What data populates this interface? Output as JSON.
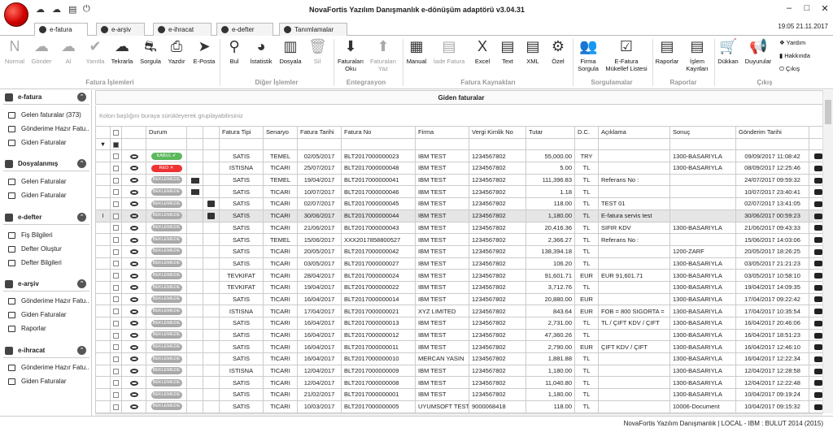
{
  "window": {
    "title": "NovaFortis Yazılım Danışmanlık e-dönüşüm adaptörü v3.04.31",
    "clock": "19:05 21.11.2017"
  },
  "tabs": [
    {
      "label": "e-fatura"
    },
    {
      "label": "e-arşiv"
    },
    {
      "label": "e-ihracat"
    },
    {
      "label": "e-defter"
    },
    {
      "label": "Tanımlamalar"
    }
  ],
  "ribbon": {
    "fatura": {
      "group": "Fatura İşlemleri",
      "normal": "Normal",
      "gonder": "Gönder",
      "al": "Al",
      "yanitla": "Yanıtla",
      "tekrarla": "Tekrarla",
      "sorgula": "Sorgula",
      "yazdir": "Yazdır",
      "eposta": "E-Posta"
    },
    "diger": {
      "group": "Diğer İşlemler",
      "bul": "Bul",
      "istatistik": "İstatistik",
      "dosyala": "Dosyala",
      "sil": "Sil"
    },
    "entegrasyon": {
      "group": "Entegrasyon",
      "oku": "Faturaları Oku",
      "yaz": "Faturaları Yaz"
    },
    "kaynak": {
      "group": "Fatura Kaynakları",
      "manual": "Manual",
      "iade": "İade Fatura",
      "excel": "Excel",
      "text": "Text",
      "xml": "XML",
      "ozel": "Özel"
    },
    "sorgu": {
      "group": "Sorgulamalar",
      "firma": "Firma Sorgula",
      "mukellef": "E-Fatura Mükellef Listesi"
    },
    "raporlar": {
      "group": "Raporlar",
      "raporlar": "Raporlar",
      "islem": "İşlem Kayıtları"
    },
    "cikis": {
      "group": "Çıkış",
      "dukkan": "Dükkan",
      "duyurular": "Duyurular",
      "yardim": "Yardım",
      "hakkinda": "Hakkında",
      "cikis": "Çıkış"
    }
  },
  "sidebar": {
    "efatura": {
      "title": "e-fatura",
      "items": [
        "Gelen faturalar (373)",
        "Gönderime Hazır Fatu...",
        "Giden Faturalar"
      ]
    },
    "dosyalanmis": {
      "title": "Dosyalanmış",
      "items": [
        "Gelen Faturalar",
        "Giden Faturalar"
      ]
    },
    "edefter": {
      "title": "e-defter",
      "items": [
        "Fiş Bilgileri",
        "Defter Oluştur",
        "Defter Bilgileri"
      ]
    },
    "earsiv": {
      "title": "e-arşiv",
      "items": [
        "Gönderime Hazır Fatu...",
        "Giden Faturalar",
        "Raporlar"
      ]
    },
    "eihracat": {
      "title": "e-ihracat",
      "items": [
        "Gönderime Hazır Fatu...",
        "Giden Faturalar"
      ]
    }
  },
  "grid": {
    "title": "Giden faturalar",
    "group_hint": "Kolon başlığını buraya sürükleyerek gruplayabilirsiniz",
    "columns": [
      "Durum",
      "Fatura Tipi",
      "Senaryo",
      "Fatura Tarihi",
      "Fatura No",
      "Firma",
      "Vergi Kimlik No",
      "Tutar",
      "D.C.",
      "Açıklama",
      "Sonuç",
      "Gönderim Tarihi"
    ],
    "rows": [
      {
        "durum": "KABUL",
        "mail": false,
        "print": false,
        "tip": "SATIS",
        "senaryo": "TEMEL",
        "tarih": "02/05/2017",
        "no": "BLT2017000000023",
        "firma": "IBM TEST",
        "vkn": "1234567802",
        "tutar": "55,000.00",
        "dc": "TRY",
        "aciklama": "",
        "sonuc": "1300-BASARIYLA",
        "gonderim": "09/09/2017 11:08:42"
      },
      {
        "durum": "RED",
        "mail": false,
        "print": false,
        "tip": "ISTISNA",
        "senaryo": "TICARI",
        "tarih": "25/07/2017",
        "no": "BLT2017000000048",
        "firma": "IBM TEST",
        "vkn": "1234567802",
        "tutar": "5.00",
        "dc": "TL",
        "aciklama": "",
        "sonuc": "1300-BASARIYLA",
        "gonderim": "08/09/2017 12:25:46"
      },
      {
        "durum": "BEKLEMEDE",
        "mail": true,
        "print": false,
        "tip": "SATIS",
        "senaryo": "TEMEL",
        "tarih": "19/04/2017",
        "no": "BLT2017000000041",
        "firma": "IBM TEST",
        "vkn": "1234567802",
        "tutar": "111,396.83",
        "dc": "TL",
        "aciklama": "Referans No :",
        "sonuc": "",
        "gonderim": "24/07/2017 09:59:32"
      },
      {
        "durum": "BEKLEMEDE",
        "mail": true,
        "print": false,
        "tip": "SATIS",
        "senaryo": "TICARI",
        "tarih": "10/07/2017",
        "no": "BLT2017000000046",
        "firma": "IBM TEST",
        "vkn": "1234567802",
        "tutar": "1.18",
        "dc": "TL",
        "aciklama": "",
        "sonuc": "",
        "gonderim": "10/07/2017 23:40:41"
      },
      {
        "durum": "BEKLEMEDE",
        "mail": false,
        "print": true,
        "tip": "SATIS",
        "senaryo": "TICARI",
        "tarih": "02/07/2017",
        "no": "BLT2017000000045",
        "firma": "IBM TEST",
        "vkn": "1234567802",
        "tutar": "118.00",
        "dc": "TL",
        "aciklama": "TEST 01",
        "sonuc": "",
        "gonderim": "02/07/2017 13:41:05"
      },
      {
        "durum": "BEKLEMEDE",
        "mail": false,
        "print": true,
        "tip": "SATIS",
        "senaryo": "TICARI",
        "tarih": "30/06/2017",
        "no": "BLT2017000000044",
        "firma": "IBM TEST",
        "vkn": "1234567802",
        "tutar": "1,180.00",
        "dc": "TL",
        "aciklama": "E-fatura servis test",
        "sonuc": "",
        "gonderim": "30/06/2017 00:59:23",
        "sel": true
      },
      {
        "durum": "BEKLEMEDE",
        "mail": false,
        "print": false,
        "tip": "SATIS",
        "senaryo": "TICARI",
        "tarih": "21/06/2017",
        "no": "BLT2017000000043",
        "firma": "IBM TEST",
        "vkn": "1234567802",
        "tutar": "20,416.36",
        "dc": "TL",
        "aciklama": "SIFIR KDV",
        "sonuc": "1300-BASARIYLA",
        "gonderim": "21/06/2017 09:43:33"
      },
      {
        "durum": "BEKLEMEDE",
        "mail": false,
        "print": false,
        "tip": "SATIS",
        "senaryo": "TEMEL",
        "tarih": "15/06/2017",
        "no": "XXX2017858800527",
        "firma": "IBM TEST",
        "vkn": "1234567802",
        "tutar": "2,366.27",
        "dc": "TL",
        "aciklama": "Referans No :",
        "sonuc": "",
        "gonderim": "15/06/2017 14:03:06"
      },
      {
        "durum": "BEKLEMEDE",
        "mail": false,
        "print": false,
        "tip": "SATIS",
        "senaryo": "TICARI",
        "tarih": "20/05/2017",
        "no": "BLT2017000000042",
        "firma": "IBM TEST",
        "vkn": "1234567802",
        "tutar": "138,394.18",
        "dc": "TL",
        "aciklama": "",
        "sonuc": "1200-ZARF",
        "gonderim": "20/05/2017 18:26:25"
      },
      {
        "durum": "BEKLEMEDE",
        "mail": false,
        "print": false,
        "tip": "SATIS",
        "senaryo": "TICARI",
        "tarih": "03/05/2017",
        "no": "BLT2017000000027",
        "firma": "IBM TEST",
        "vkn": "1234567802",
        "tutar": "106.20",
        "dc": "TL",
        "aciklama": "",
        "sonuc": "1300-BASARIYLA",
        "gonderim": "03/05/2017 21:21:23"
      },
      {
        "durum": "BEKLEMEDE",
        "mail": false,
        "print": false,
        "tip": "TEVKIFAT",
        "senaryo": "TICARI",
        "tarih": "28/04/2017",
        "no": "BLT2017000000024",
        "firma": "IBM TEST",
        "vkn": "1234567802",
        "tutar": "91,601.71",
        "dc": "EUR",
        "aciklama": "EUR 91,601.71",
        "sonuc": "1300-BASARIYLA",
        "gonderim": "03/05/2017 10:58:10"
      },
      {
        "durum": "BEKLEMEDE",
        "mail": false,
        "print": false,
        "tip": "TEVKIFAT",
        "senaryo": "TICARI",
        "tarih": "19/04/2017",
        "no": "BLT2017000000022",
        "firma": "IBM TEST",
        "vkn": "1234567802",
        "tutar": "3,712.76",
        "dc": "TL",
        "aciklama": "",
        "sonuc": "1300-BASARIYLA",
        "gonderim": "19/04/2017 14:09:35"
      },
      {
        "durum": "BEKLEMEDE",
        "mail": false,
        "print": false,
        "tip": "SATIS",
        "senaryo": "TICARI",
        "tarih": "16/04/2017",
        "no": "BLT2017000000014",
        "firma": "IBM TEST",
        "vkn": "1234567802",
        "tutar": "20,880.00",
        "dc": "EUR",
        "aciklama": "",
        "sonuc": "1300-BASARIYLA",
        "gonderim": "17/04/2017 09:22:42"
      },
      {
        "durum": "BEKLEMEDE",
        "mail": false,
        "print": false,
        "tip": "ISTISNA",
        "senaryo": "TICARI",
        "tarih": "17/04/2017",
        "no": "BLT2017000000021",
        "firma": "XYZ LIMITED",
        "vkn": "1234567802",
        "tutar": "843.64",
        "dc": "EUR",
        "aciklama": "FOB = 800 SIGORTA =",
        "sonuc": "1300-BASARIYLA",
        "gonderim": "17/04/2017 10:35:54"
      },
      {
        "durum": "BEKLEMEDE",
        "mail": false,
        "print": false,
        "tip": "SATIS",
        "senaryo": "TICARI",
        "tarih": "16/04/2017",
        "no": "BLT2017000000013",
        "firma": "IBM TEST",
        "vkn": "1234567802",
        "tutar": "2,731.00",
        "dc": "TL",
        "aciklama": "TL / ÇIFT KDV / ÇIFT",
        "sonuc": "1300-BASARIYLA",
        "gonderim": "16/04/2017 20:46:06"
      },
      {
        "durum": "BEKLEMEDE",
        "mail": false,
        "print": false,
        "tip": "SATIS",
        "senaryo": "TICARI",
        "tarih": "16/04/2017",
        "no": "BLT2017000000012",
        "firma": "IBM TEST",
        "vkn": "1234567802",
        "tutar": "47,360.26",
        "dc": "TL",
        "aciklama": "",
        "sonuc": "1300-BASARIYLA",
        "gonderim": "16/04/2017 18:51:23"
      },
      {
        "durum": "BEKLEMEDE",
        "mail": false,
        "print": false,
        "tip": "SATIS",
        "senaryo": "TICARI",
        "tarih": "16/04/2017",
        "no": "BLT2017000000011",
        "firma": "IBM TEST",
        "vkn": "1234567802",
        "tutar": "2,790.00",
        "dc": "EUR",
        "aciklama": "ÇIFT KDV / ÇIFT",
        "sonuc": "1300-BASARIYLA",
        "gonderim": "16/04/2017 12:46:10"
      },
      {
        "durum": "BEKLEMEDE",
        "mail": false,
        "print": false,
        "tip": "SATIS",
        "senaryo": "TICARI",
        "tarih": "16/04/2017",
        "no": "BLT2017000000010",
        "firma": "MERCAN YASIN",
        "vkn": "1234567802",
        "tutar": "1,881.88",
        "dc": "TL",
        "aciklama": "",
        "sonuc": "1300-BASARIYLA",
        "gonderim": "16/04/2017 12:22:34"
      },
      {
        "durum": "BEKLEMEDE",
        "mail": false,
        "print": false,
        "tip": "ISTISNA",
        "senaryo": "TICARI",
        "tarih": "12/04/2017",
        "no": "BLT2017000000009",
        "firma": "IBM TEST",
        "vkn": "1234567802",
        "tutar": "1,180.00",
        "dc": "TL",
        "aciklama": "",
        "sonuc": "1300-BASARIYLA",
        "gonderim": "12/04/2017 12:28:58"
      },
      {
        "durum": "BEKLEMEDE",
        "mail": false,
        "print": false,
        "tip": "SATIS",
        "senaryo": "TICARI",
        "tarih": "12/04/2017",
        "no": "BLT2017000000008",
        "firma": "IBM TEST",
        "vkn": "1234567802",
        "tutar": "11,040.80",
        "dc": "TL",
        "aciklama": "",
        "sonuc": "1300-BASARIYLA",
        "gonderim": "12/04/2017 12:22:48"
      },
      {
        "durum": "BEKLEMEDE",
        "mail": false,
        "print": false,
        "tip": "SATIS",
        "senaryo": "TICARI",
        "tarih": "21/02/2017",
        "no": "BLT2017000000001",
        "firma": "IBM TEST",
        "vkn": "1234567802",
        "tutar": "1,180.00",
        "dc": "TL",
        "aciklama": "",
        "sonuc": "1300-BASARIYLA",
        "gonderim": "10/04/2017 09:19:24"
      },
      {
        "durum": "BEKLEMEDE",
        "mail": false,
        "print": false,
        "tip": "SATIS",
        "senaryo": "TICARI",
        "tarih": "10/03/2017",
        "no": "BLT2017000000005",
        "firma": "UYUMSOFT TEST",
        "vkn": "9000068418",
        "tutar": "118.00",
        "dc": "TL",
        "aciklama": "",
        "sonuc": "10006-Document",
        "gonderim": "10/04/2017 09:15:32"
      }
    ]
  },
  "status": "NovaFortis Yazılım Danışmanlık | LOCAL - IBM : BULUT 2014 (2015)"
}
